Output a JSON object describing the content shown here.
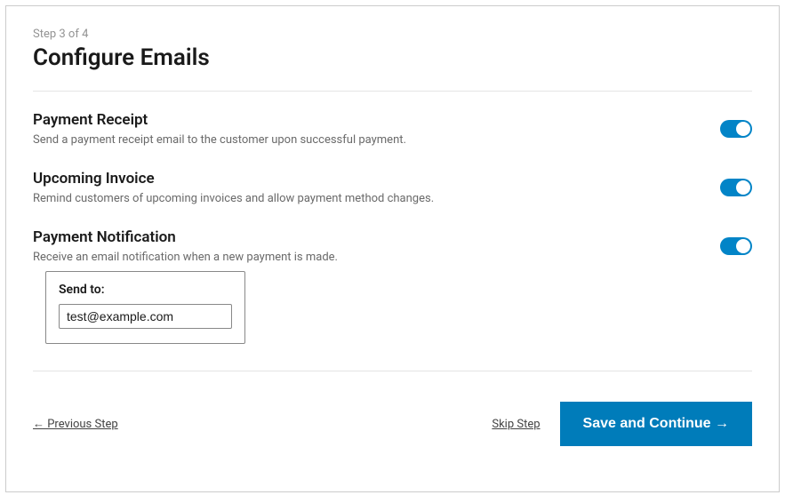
{
  "header": {
    "step_label": "Step 3 of 4",
    "title": "Configure Emails"
  },
  "settings": {
    "payment_receipt": {
      "title": "Payment Receipt",
      "desc": "Send a payment receipt email to the customer upon successful payment.",
      "enabled": true
    },
    "upcoming_invoice": {
      "title": "Upcoming Invoice",
      "desc": "Remind customers of upcoming invoices and allow payment method changes.",
      "enabled": true
    },
    "payment_notification": {
      "title": "Payment Notification",
      "desc": "Receive an email notification when a new payment is made.",
      "enabled": true,
      "send_to_label": "Send to:",
      "send_to_value": "test@example.com"
    }
  },
  "footer": {
    "previous": "← Previous Step",
    "skip": "Skip Step",
    "save": "Save and Continue →"
  }
}
